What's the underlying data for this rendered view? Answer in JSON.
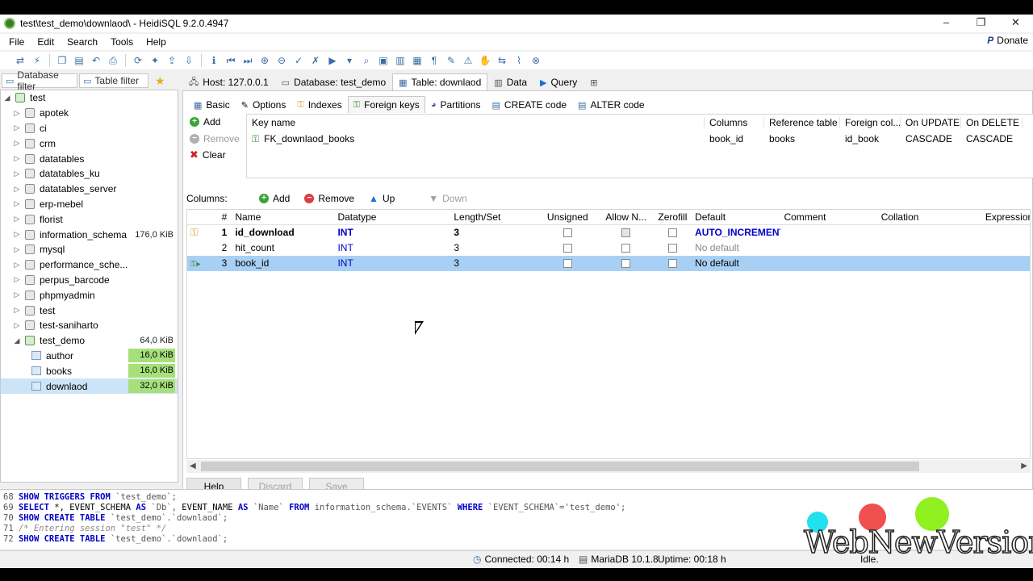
{
  "window": {
    "title": "test\\test_demo\\downlaod\\ - HeidiSQL 9.2.0.4947",
    "min": "–",
    "max": "❐",
    "close": "✕"
  },
  "menu": {
    "items": [
      "File",
      "Edit",
      "Search",
      "Tools",
      "Help"
    ],
    "donate": "Donate"
  },
  "filters": {
    "database": "Database filter",
    "table": "Table filter"
  },
  "tree": {
    "root": "test",
    "databases": [
      {
        "name": "apotek",
        "size": ""
      },
      {
        "name": "ci",
        "size": ""
      },
      {
        "name": "crm",
        "size": ""
      },
      {
        "name": "datatables",
        "size": ""
      },
      {
        "name": "datatables_ku",
        "size": ""
      },
      {
        "name": "datatables_server",
        "size": ""
      },
      {
        "name": "erp-mebel",
        "size": ""
      },
      {
        "name": "florist",
        "size": ""
      },
      {
        "name": "information_schema",
        "size": "176,0 KiB"
      },
      {
        "name": "mysql",
        "size": ""
      },
      {
        "name": "performance_sche...",
        "size": ""
      },
      {
        "name": "perpus_barcode",
        "size": ""
      },
      {
        "name": "phpmyadmin",
        "size": ""
      },
      {
        "name": "test",
        "size": ""
      },
      {
        "name": "test-saniharto",
        "size": ""
      }
    ],
    "open_db": {
      "name": "test_demo",
      "size": "64,0 KiB"
    },
    "tables": [
      {
        "name": "author",
        "size": "16,0 KiB"
      },
      {
        "name": "books",
        "size": "16,0 KiB"
      },
      {
        "name": "downlaod",
        "size": "32,0 KiB"
      }
    ]
  },
  "main_tabs": [
    "Host: 127.0.0.1",
    "Database: test_demo",
    "Table: downlaod",
    "Data",
    "Query"
  ],
  "sub_tabs": [
    "Basic",
    "Options",
    "Indexes",
    "Foreign keys",
    "Partitions",
    "CREATE code",
    "ALTER code"
  ],
  "fk_buttons": {
    "add": "Add",
    "remove": "Remove",
    "clear": "Clear"
  },
  "fk_grid": {
    "headers": [
      "Key name",
      "Columns",
      "Reference table",
      "Foreign col...",
      "On UPDATE",
      "On DELETE"
    ],
    "rows": [
      [
        "FK_downlaod_books",
        "book_id",
        "books",
        "id_book",
        "CASCADE",
        "CASCADE"
      ]
    ]
  },
  "columns_bar": {
    "label": "Columns:",
    "add": "Add",
    "remove": "Remove",
    "up": "Up",
    "down": "Down"
  },
  "columns_grid": {
    "headers": [
      "#",
      "Name",
      "Datatype",
      "Length/Set",
      "Unsigned",
      "Allow N...",
      "Zerofill",
      "Default",
      "Comment",
      "Collation",
      "Expression"
    ],
    "rows": [
      {
        "num": "1",
        "name": "id_download",
        "type": "INT",
        "len": "3",
        "default": "AUTO_INCREMENT"
      },
      {
        "num": "2",
        "name": "hit_count",
        "type": "INT",
        "len": "3",
        "default": "No default"
      },
      {
        "num": "3",
        "name": "book_id",
        "type": "INT",
        "len": "3",
        "default": "No default"
      }
    ]
  },
  "bottom_buttons": {
    "help": "Help",
    "discard": "Discard",
    "save": "Save"
  },
  "log": [
    {
      "n": "68",
      "text": "SHOW TRIGGERS FROM `test_demo`;"
    },
    {
      "n": "69",
      "text": "SELECT *, EVENT_SCHEMA AS `Db`, EVENT_NAME AS `Name` FROM information_schema.`EVENTS` WHERE `EVENT_SCHEMA`='test_demo';"
    },
    {
      "n": "70",
      "text": "SHOW CREATE TABLE `test_demo`.`downlaod`;"
    },
    {
      "n": "71",
      "text": "/* Entering session \"test\" */"
    },
    {
      "n": "72",
      "text": "SHOW CREATE TABLE `test_demo`.`downlaod`;"
    }
  ],
  "status": {
    "connected": "Connected: 00:14 h",
    "server": "MariaDB 10.1.8",
    "uptime": "Uptime: 00:18 h",
    "idle": "Idle."
  },
  "watermark": "WebNewVersion",
  "colors": {
    "selection": "#a8d0f5",
    "size_bar": "#a6e07a",
    "keyword": "#0000c8"
  }
}
